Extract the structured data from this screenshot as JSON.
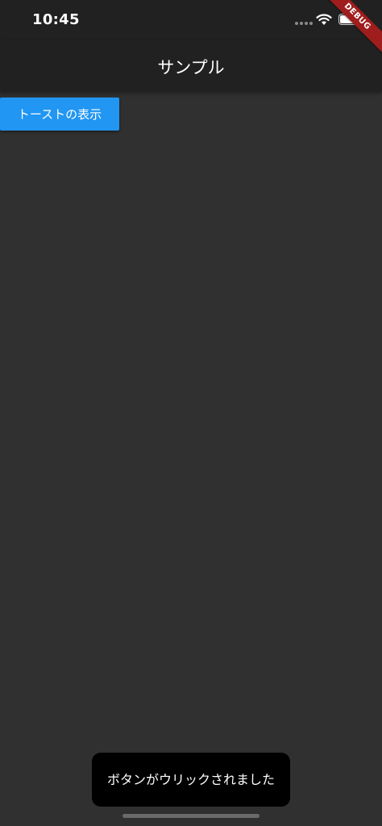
{
  "status_bar": {
    "time": "10:45",
    "icons": [
      "signal-dots-icon",
      "wifi-icon",
      "battery-icon"
    ]
  },
  "debug_banner": {
    "label": "DEBUG"
  },
  "app_bar": {
    "title": "サンプル",
    "background": "#212121"
  },
  "main": {
    "toast_button_label": "トーストの表示",
    "button_color": "#2196f3",
    "background": "#303030"
  },
  "toast": {
    "message": "ボタンがウリックされました"
  }
}
